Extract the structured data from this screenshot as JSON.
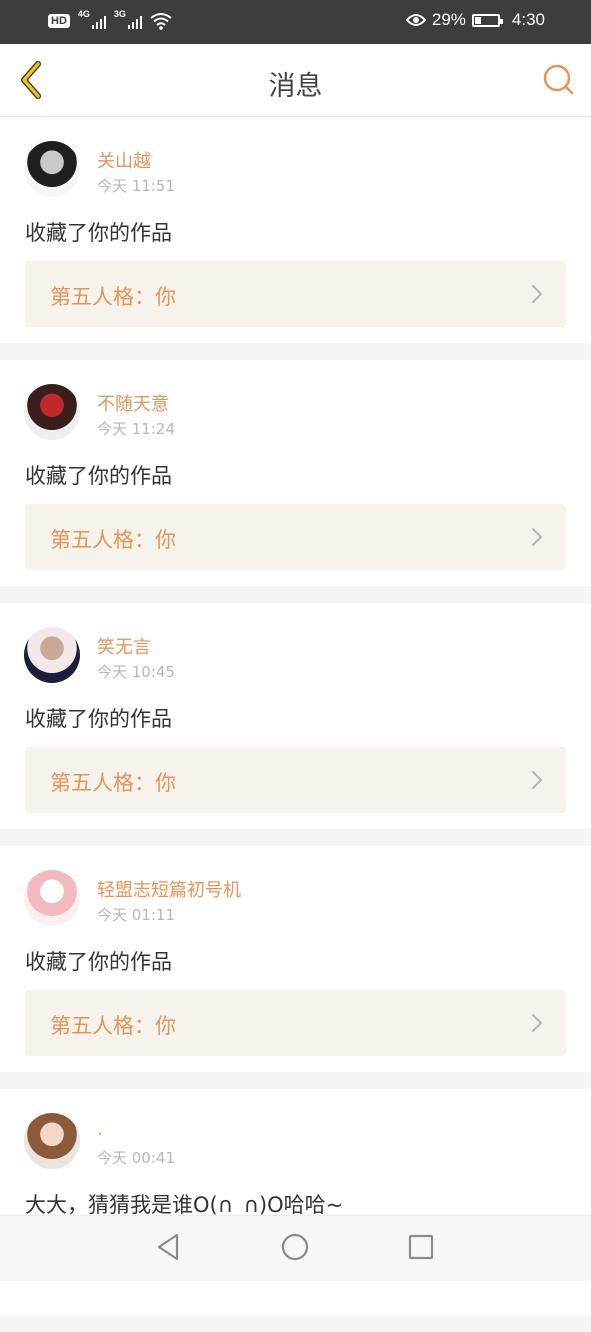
{
  "status_bar": {
    "hd": "HD",
    "net1": "4G",
    "net2": "3G",
    "battery_percent": "29%",
    "battery_level": 0.29,
    "time": "4:30",
    "icons": [
      "hd-icon",
      "signal-icon",
      "wifi-icon",
      "eye-icon",
      "battery-icon"
    ]
  },
  "nav": {
    "title": "消息",
    "back_icon": "chevron-left-icon",
    "search_icon": "search-icon"
  },
  "colors": {
    "accent": "#e3955b",
    "back_icon": "#e8c13a",
    "link_bg": "#f5f3eb",
    "text": "#333333",
    "muted": "#b7b7b7"
  },
  "messages": [
    {
      "username": "关山越",
      "time": "今天 11:51",
      "action": "收藏了你的作品",
      "work": "第五人格：你",
      "avatar_palette": [
        "#f6f6f6",
        "#1f1f1f",
        "#c9c9c9"
      ]
    },
    {
      "username": "不随天意",
      "time": "今天 11:24",
      "action": "收藏了你的作品",
      "work": "第五人格：你",
      "avatar_palette": [
        "#eeeeee",
        "#3a1d1d",
        "#c0282b"
      ]
    },
    {
      "username": "笑无言",
      "time": "今天 10:45",
      "action": "收藏了你的作品",
      "work": "第五人格：你",
      "avatar_palette": [
        "#1b1e3a",
        "#f3e9ea",
        "#c6aa94"
      ]
    },
    {
      "username": "轻盟志短篇初号机",
      "time": "今天 01:11",
      "action": "收藏了你的作品",
      "work": "第五人格：你",
      "avatar_palette": [
        "#fbeff0",
        "#f2b9c2",
        "#ffffff"
      ]
    },
    {
      "username": ".",
      "time": "今天 00:41",
      "action": "大大，猜猜我是谁O(∩_∩)O哈哈~",
      "work": "",
      "avatar_palette": [
        "#ece4df",
        "#8a5a3b",
        "#f3d6c6"
      ]
    }
  ],
  "bottom_nav": {
    "icons": [
      "back-triangle-icon",
      "home-circle-icon",
      "recents-square-icon"
    ]
  }
}
